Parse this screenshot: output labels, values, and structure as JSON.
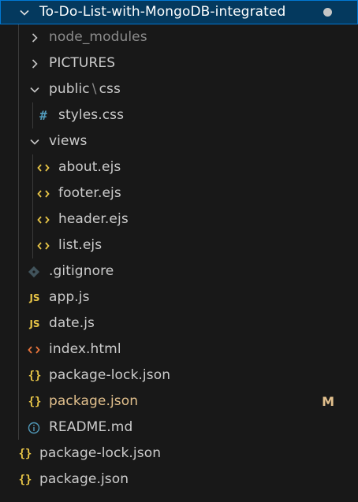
{
  "explorer": {
    "root": {
      "label": "To-Do-List-with-MongoDB-integrated",
      "state": "expanded",
      "has_changes_dot": true
    },
    "items": [
      {
        "label": "node_modules",
        "type": "folder",
        "state": "collapsed",
        "icon": "chevron-right-icon",
        "muted": true
      },
      {
        "label": "PICTURES",
        "type": "folder",
        "state": "collapsed",
        "icon": "chevron-right-icon"
      },
      {
        "label": "public",
        "separator": "\\",
        "label_suffix": "css",
        "type": "folder",
        "state": "expanded",
        "icon": "chevron-down-icon"
      },
      {
        "label": "styles.css",
        "type": "file",
        "icon": "css-hash-icon",
        "icon_glyph": "#"
      },
      {
        "label": "views",
        "type": "folder",
        "state": "expanded",
        "icon": "chevron-down-icon"
      },
      {
        "label": "about.ejs",
        "type": "file",
        "icon": "ejs-icon",
        "icon_glyph": "<>"
      },
      {
        "label": "footer.ejs",
        "type": "file",
        "icon": "ejs-icon",
        "icon_glyph": "<>"
      },
      {
        "label": "header.ejs",
        "type": "file",
        "icon": "ejs-icon",
        "icon_glyph": "<>"
      },
      {
        "label": "list.ejs",
        "type": "file",
        "icon": "ejs-icon",
        "icon_glyph": "<>"
      },
      {
        "label": ".gitignore",
        "type": "file",
        "icon": "git-icon"
      },
      {
        "label": "app.js",
        "type": "file",
        "icon": "js-icon",
        "icon_glyph": "JS"
      },
      {
        "label": "date.js",
        "type": "file",
        "icon": "js-icon",
        "icon_glyph": "JS"
      },
      {
        "label": "index.html",
        "type": "file",
        "icon": "html-icon",
        "icon_glyph": "<>"
      },
      {
        "label": "package-lock.json",
        "type": "file",
        "icon": "json-icon",
        "icon_glyph": "{}"
      },
      {
        "label": "package.json",
        "type": "file",
        "icon": "json-icon",
        "icon_glyph": "{}",
        "modified": true,
        "badge": "M"
      },
      {
        "label": "README.md",
        "type": "file",
        "icon": "info-icon"
      },
      {
        "label": "package-lock.json",
        "type": "file",
        "icon": "json-icon",
        "icon_glyph": "{}"
      },
      {
        "label": "package.json",
        "type": "file",
        "icon": "json-icon",
        "icon_glyph": "{}"
      }
    ]
  },
  "colors": {
    "background": "#181818",
    "selected_row": "#04395e",
    "focus_border": "#0078d4",
    "text": "#cccccc",
    "modified": "#e2c08d",
    "json_js_ejs": "#e8c547",
    "html": "#e8743b",
    "css": "#519aba"
  }
}
